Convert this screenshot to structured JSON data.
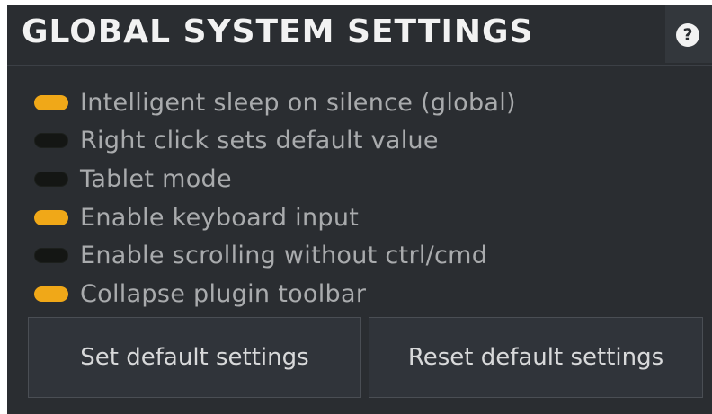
{
  "panel": {
    "title": "GLOBAL SYSTEM SETTINGS",
    "help_icon": "?"
  },
  "options": [
    {
      "label": "Intelligent sleep on silence (global)",
      "enabled": true
    },
    {
      "label": "Right click sets default value",
      "enabled": false
    },
    {
      "label": "Tablet mode",
      "enabled": false
    },
    {
      "label": "Enable keyboard input",
      "enabled": true
    },
    {
      "label": "Enable scrolling without ctrl/cmd",
      "enabled": false
    },
    {
      "label": "Collapse plugin toolbar",
      "enabled": true
    }
  ],
  "buttons": {
    "set_default": "Set default settings",
    "reset_default": "Reset default settings"
  },
  "colors": {
    "background": "#2a2d31",
    "toggle_on": "#f0a818",
    "toggle_off": "#141614",
    "text": "#a9abad"
  }
}
